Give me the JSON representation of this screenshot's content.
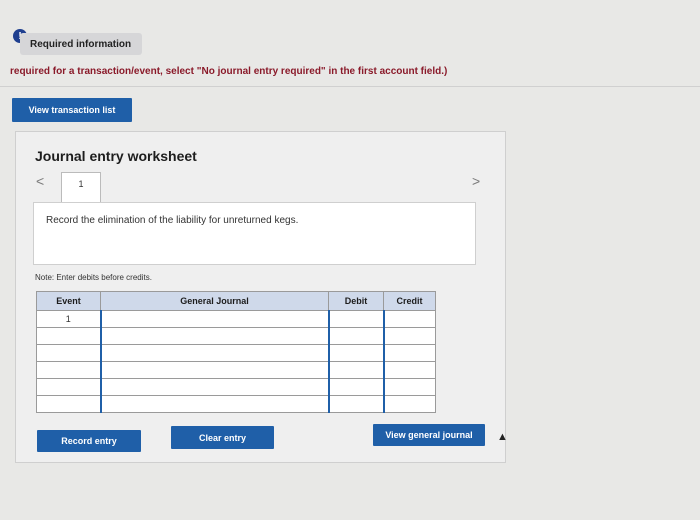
{
  "header": {
    "alert_icon": "!",
    "required_tab": "Required information",
    "instruction": "required for a transaction/event, select \"No journal entry required\" in the first account field.)"
  },
  "buttons": {
    "view_transaction_list": "View transaction list",
    "record_entry": "Record entry",
    "clear_entry": "Clear entry",
    "view_general_journal": "View general journal"
  },
  "worksheet": {
    "title": "Journal entry worksheet",
    "nav_prev": "<",
    "nav_next": ">",
    "current_tab": "1",
    "description": "Record the elimination of the liability for unreturned kegs.",
    "note": "Note: Enter debits before credits."
  },
  "table": {
    "headers": {
      "event": "Event",
      "general_journal": "General Journal",
      "debit": "Debit",
      "credit": "Credit"
    },
    "rows": [
      {
        "event": "1",
        "account": "",
        "debit": "",
        "credit": ""
      },
      {
        "event": "",
        "account": "",
        "debit": "",
        "credit": ""
      },
      {
        "event": "",
        "account": "",
        "debit": "",
        "credit": ""
      },
      {
        "event": "",
        "account": "",
        "debit": "",
        "credit": ""
      },
      {
        "event": "",
        "account": "",
        "debit": "",
        "credit": ""
      },
      {
        "event": "",
        "account": "",
        "debit": "",
        "credit": ""
      }
    ]
  },
  "colors": {
    "button_blue": "#1f5fa8",
    "header_blue": "#cfd9ea",
    "instruction_red": "#8a1a2a"
  }
}
